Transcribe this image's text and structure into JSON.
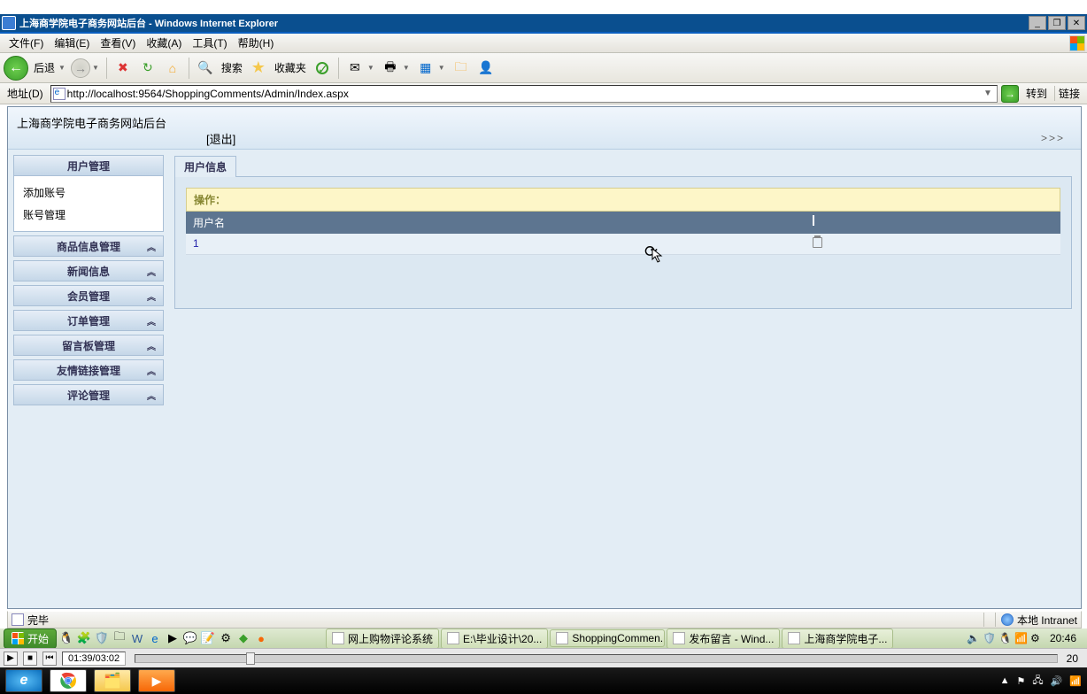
{
  "window": {
    "title": "上海商学院电子商务网站后台 - Windows Internet Explorer"
  },
  "menu": {
    "file": "文件(F)",
    "edit": "编辑(E)",
    "view": "查看(V)",
    "favorites": "收藏(A)",
    "tools": "工具(T)",
    "help": "帮助(H)"
  },
  "toolbar": {
    "back": "后退",
    "search": "搜索",
    "favorites": "收藏夹"
  },
  "address": {
    "label": "地址(D)",
    "url": "http://localhost:9564/ShoppingComments/Admin/Index.aspx",
    "go": "转到",
    "links": "链接"
  },
  "app": {
    "title": "上海商学院电子商务网站后台",
    "logout": "[退出]",
    "crumb": ">>>"
  },
  "sidebar": {
    "active": {
      "head": "用户管理",
      "items": [
        "添加账号",
        "账号管理"
      ]
    },
    "collapsed": [
      "商品信息管理",
      "新闻信息",
      "会员管理",
      "订单管理",
      "留言板管理",
      "友情链接管理",
      "评论管理"
    ]
  },
  "main": {
    "tab": "用户信息",
    "ops_label": "操作：",
    "col_user": "用户名",
    "col_action": "",
    "row": {
      "user": "1"
    }
  },
  "status": {
    "done": "完毕",
    "zone": "本地 Intranet"
  },
  "taskbar": {
    "start": "开始",
    "tasks": [
      "网上购物评论系统",
      "E:\\毕业设计\\20...",
      "ShoppingCommen...",
      "发布留言 - Wind...",
      "上海商学院电子..."
    ],
    "clock": "20:46"
  },
  "media": {
    "time": "01:39/03:02"
  },
  "outer_right_time": "20"
}
